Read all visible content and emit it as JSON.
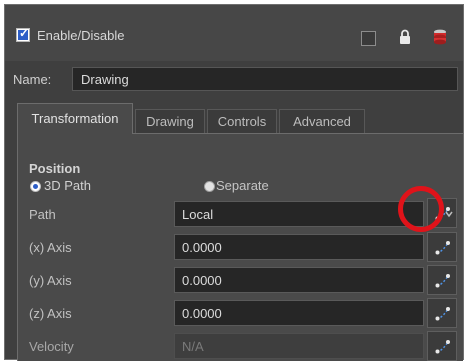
{
  "header": {
    "enable_label": "Enable/Disable",
    "enable_checked": true,
    "icons": [
      "checkbox-icon",
      "lock-icon",
      "layer-stack-icon"
    ]
  },
  "name_row": {
    "label": "Name:",
    "value": "Drawing"
  },
  "tabs": [
    {
      "label": "Transformation",
      "active": true
    },
    {
      "label": "Drawing",
      "active": false
    },
    {
      "label": "Controls",
      "active": false
    },
    {
      "label": "Advanced",
      "active": false
    }
  ],
  "position": {
    "title": "Position",
    "options": [
      {
        "label": "3D Path",
        "selected": true
      },
      {
        "label": "Separate",
        "selected": false
      }
    ],
    "rows": [
      {
        "label": "Path",
        "value": "Local"
      },
      {
        "label": "(x) Axis",
        "value": "0.0000"
      },
      {
        "label": "(y) Axis",
        "value": "0.0000"
      },
      {
        "label": "(z) Axis",
        "value": "0.0000"
      },
      {
        "label": "Velocity",
        "value": "N/A"
      }
    ]
  },
  "colors": {
    "accent": "#2d5ec7",
    "annotation_ring": "#e0131a",
    "panel": "#4a4a4a",
    "field": "#262626"
  }
}
